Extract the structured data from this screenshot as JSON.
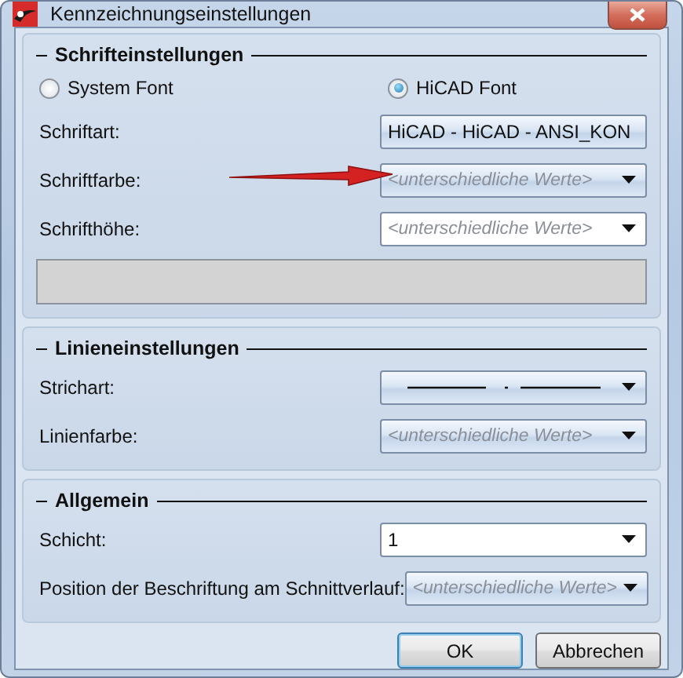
{
  "window": {
    "title": "Kennzeichnungseinstellungen"
  },
  "groups": [
    {
      "title": "Schrifteinstellungen",
      "rows": [
        {
          "kind": "radios",
          "options": [
            {
              "label": "System Font",
              "selected": false
            },
            {
              "label": "HiCAD Font",
              "selected": true
            }
          ]
        },
        {
          "kind": "combo",
          "label": "Schriftart:",
          "value": "HiCAD - HiCAD - ANSI_KON",
          "mixed": false,
          "editable": false
        },
        {
          "kind": "combo",
          "label": "Schriftfarbe:",
          "value": "<unterschiedliche Werte>",
          "mixed": true,
          "editable": false,
          "pointer_arrow": true
        },
        {
          "kind": "combo",
          "label": "Schrifthöhe:",
          "value": "<unterschiedliche Werte>",
          "mixed": true,
          "editable": true
        },
        {
          "kind": "preview"
        }
      ]
    },
    {
      "title": "Linieneinstellungen",
      "rows": [
        {
          "kind": "linestyle",
          "label": "Strichart:"
        },
        {
          "kind": "combo",
          "label": "Linienfarbe:",
          "value": "<unterschiedliche Werte>",
          "mixed": true,
          "editable": false
        }
      ]
    },
    {
      "title": "Allgemein",
      "rows": [
        {
          "kind": "combo",
          "label": "Schicht:",
          "value": "1",
          "mixed": false,
          "editable": true
        },
        {
          "kind": "combo",
          "label": "Position der Beschriftung am Schnittverlauf:",
          "value": "<unterschiedliche Werte>",
          "mixed": true,
          "editable": false
        }
      ]
    }
  ],
  "buttons": [
    {
      "label": "OK",
      "default": true
    },
    {
      "label": "Abbrechen",
      "default": false
    }
  ]
}
